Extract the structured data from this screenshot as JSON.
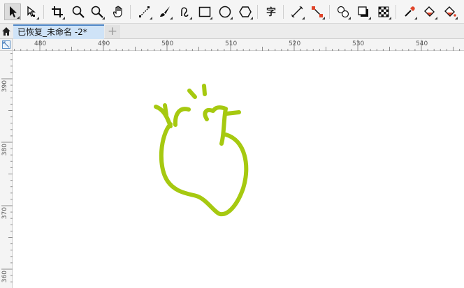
{
  "toolbar": {
    "tools": [
      {
        "name": "pick-tool",
        "icon": "pointer-arrow-icon",
        "active": true
      },
      {
        "name": "shape-tool",
        "icon": "shape-node-icon"
      },
      {
        "name": "crop-tool",
        "icon": "crop-icon"
      },
      {
        "name": "zoom-tool",
        "icon": "zoom-icon"
      },
      {
        "name": "pan-tool",
        "icon": "hand-icon"
      },
      {
        "name": "freehand-tool",
        "icon": "freehand-icon"
      },
      {
        "name": "artistic-media-tool",
        "icon": "brush-icon"
      },
      {
        "name": "smart-drawing-tool",
        "icon": "smart-curve-icon"
      },
      {
        "name": "rectangle-tool",
        "icon": "rectangle-icon"
      },
      {
        "name": "ellipse-tool",
        "icon": "ellipse-icon"
      },
      {
        "name": "polygon-tool",
        "icon": "polygon-icon"
      },
      {
        "name": "text-tool",
        "icon": "text-icon",
        "glyph": "字"
      },
      {
        "name": "parallel-dimension-tool",
        "icon": "dimension-icon"
      },
      {
        "name": "connector-tool",
        "icon": "connector-icon"
      },
      {
        "name": "blend-tool",
        "icon": "blend-icon"
      },
      {
        "name": "drop-shadow-tool",
        "icon": "shadow-icon"
      },
      {
        "name": "transparency-tool",
        "icon": "checker-icon"
      },
      {
        "name": "eyedropper-tool",
        "icon": "eyedropper-icon"
      },
      {
        "name": "interactive-fill-tool",
        "icon": "fill-bucket-icon"
      },
      {
        "name": "smart-fill-tool",
        "icon": "smart-fill-icon"
      }
    ]
  },
  "tabs": {
    "home_icon": "home-icon",
    "document_title": "已恢复_未命名 -2*",
    "new_tab_label": "+"
  },
  "rulers": {
    "horizontal_labels": [
      "480",
      "490",
      "500",
      "510",
      "520",
      "530",
      "540"
    ],
    "vertical_labels": [
      "390",
      "380",
      "370",
      "360"
    ]
  },
  "colors": {
    "drawing_stroke": "#a6c910",
    "tab_active_bg": "#cfe3f7",
    "tab_accent": "#4f86c6",
    "canvas_bg": "#ffffff"
  }
}
